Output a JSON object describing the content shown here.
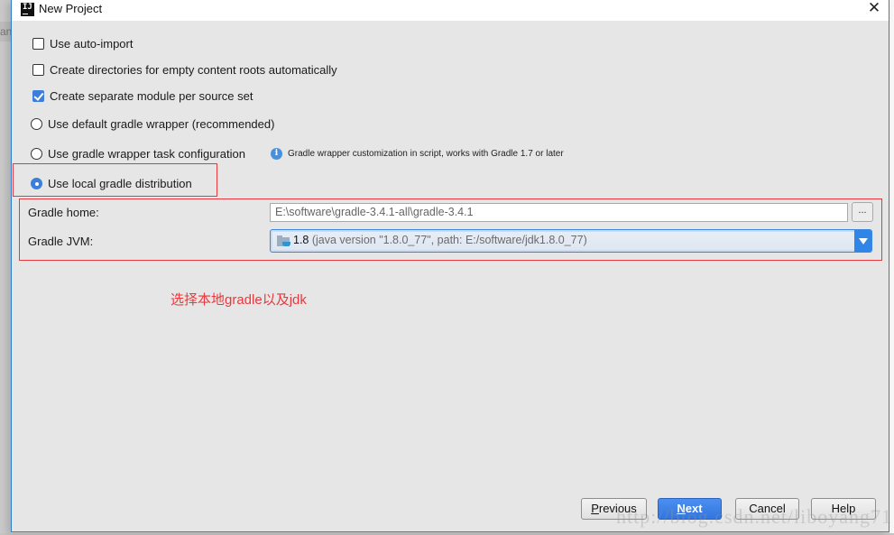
{
  "window": {
    "title": "New Project",
    "app_icon_label": "IJ",
    "close_glyph": "✕"
  },
  "background": {
    "left_strip_text": "an"
  },
  "options": {
    "checkboxes": [
      {
        "label": "Use auto-import",
        "checked": false
      },
      {
        "label": "Create directories for empty content roots automatically",
        "checked": false
      },
      {
        "label": "Create separate module per source set",
        "checked": true
      }
    ],
    "radios": [
      {
        "label": "Use default gradle wrapper (recommended)",
        "selected": false
      },
      {
        "label": "Use gradle wrapper task configuration",
        "selected": false
      },
      {
        "label": "Use local gradle distribution",
        "selected": true
      }
    ],
    "wrapper_hint": "Gradle wrapper customization in script, works with Gradle 1.7 or later",
    "info_glyph": "i"
  },
  "fields": {
    "gradle_home_label": "Gradle home:",
    "gradle_home_value": "E:\\software\\gradle-3.4.1-all\\gradle-3.4.1",
    "browse_label": "...",
    "gradle_jvm_label": "Gradle JVM:",
    "gradle_jvm_version": "1.8",
    "gradle_jvm_detail": " (java version \"1.8.0_77\", path: E:/software/jdk1.8.0_77)"
  },
  "annotation": {
    "note": "选择本地gradle以及jdk",
    "color": "#e8383d"
  },
  "buttons": {
    "previous_mnemonic": "P",
    "previous_rest": "revious",
    "next_mnemonic": "N",
    "next_rest": "ext",
    "cancel": "Cancel",
    "help": "Help"
  },
  "watermark": "http://blog.csdn.net/liboyang71",
  "colors": {
    "accent": "#3b7fdb",
    "dialog_border": "#2b7fd0",
    "dialog_bg": "#e6e6e6"
  }
}
